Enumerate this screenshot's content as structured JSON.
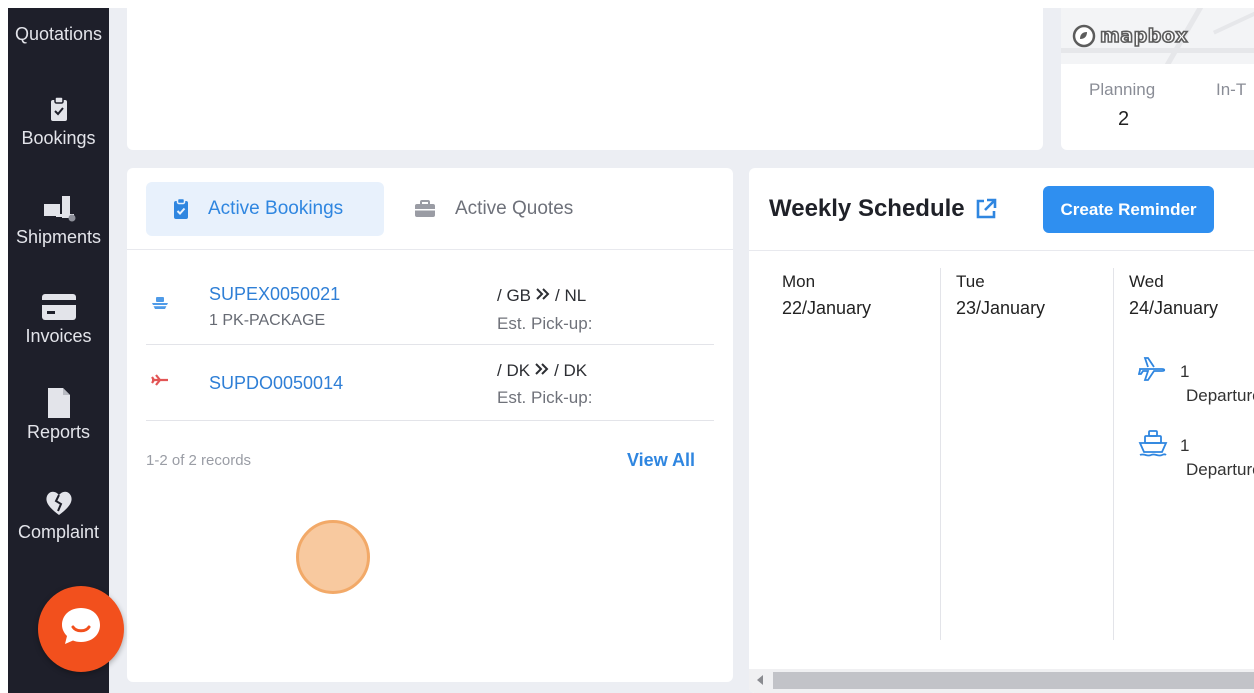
{
  "sidebar": {
    "items": [
      {
        "label": "Quotations",
        "icon": "inbox-icon"
      },
      {
        "label": "Bookings",
        "icon": "clipboard-check-icon"
      },
      {
        "label": "Shipments",
        "icon": "truck-box-icon"
      },
      {
        "label": "Invoices",
        "icon": "credit-card-icon"
      },
      {
        "label": "Reports",
        "icon": "document-icon"
      },
      {
        "label": "Complaint",
        "icon": "broken-heart-icon"
      }
    ]
  },
  "map": {
    "attribution": "mapbox"
  },
  "stats": [
    {
      "label": "Planning",
      "value": "2"
    },
    {
      "label": "In-T",
      "value": ""
    }
  ],
  "bookings_card": {
    "tabs": [
      {
        "label": "Active Bookings",
        "icon": "clipboard-check-icon",
        "active": true
      },
      {
        "label": "Active Quotes",
        "icon": "briefcase-icon",
        "active": false
      }
    ],
    "rows": [
      {
        "ref": "SUPEX0050021",
        "package": "1 PK-PACKAGE",
        "from": "/ GB",
        "to": "/ NL",
        "pickup": "Est. Pick-up:",
        "mode_icon": "ship-icon"
      },
      {
        "ref": "SUPDO0050014",
        "package": "",
        "from": "/ DK",
        "to": "/ DK",
        "pickup": "Est. Pick-up:",
        "mode_icon": "plane-icon"
      }
    ],
    "records": "1-2 of 2 records",
    "view_all": "View All"
  },
  "schedule": {
    "title": "Weekly Schedule",
    "create_reminder": "Create Reminder",
    "days": [
      {
        "name": "Mon",
        "date": "22/January"
      },
      {
        "name": "Tue",
        "date": "23/January"
      },
      {
        "name": "Wed",
        "date": "24/January"
      }
    ],
    "events": [
      {
        "count": "1",
        "label": "Departures",
        "icon": "plane-icon"
      },
      {
        "count": "1",
        "label": "Departures",
        "icon": "ship-icon"
      }
    ]
  },
  "colors": {
    "accent": "#2f86e0",
    "sidebar": "#1e1f2a",
    "chat": "#f2501d",
    "background": "#eceef3"
  }
}
